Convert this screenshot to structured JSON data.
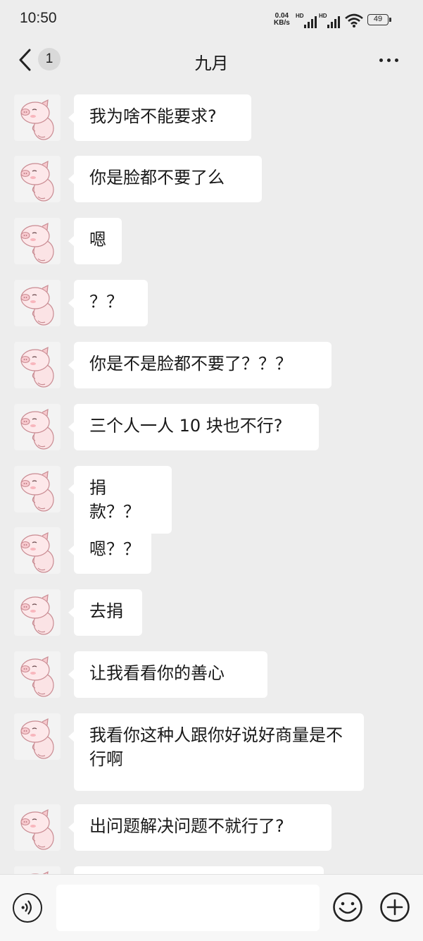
{
  "status_bar": {
    "time": "10:50",
    "net_speed_value": "0.04",
    "net_speed_unit": "KB/s",
    "signal1_label": "HD",
    "signal2_label": "HD",
    "battery": "49"
  },
  "header": {
    "unread_count": "1",
    "title": "九月"
  },
  "messages": [
    {
      "text": "我为啥不能要求?"
    },
    {
      "text": "你是脸都不要了么"
    },
    {
      "text": "嗯"
    },
    {
      "text": "？？"
    },
    {
      "text": "你是不是脸都不要了？？？"
    },
    {
      "text": "三个人一人 10 块也不行?"
    },
    {
      "text": "捐款？？"
    },
    {
      "text": "嗯？？"
    },
    {
      "text": "去捐"
    },
    {
      "text": "让我看看你的善心"
    },
    {
      "text": "我看你这种人跟你好说好商量是不行啊"
    },
    {
      "text": "出问题解决问题不就行了?"
    },
    {
      "text": ""
    }
  ],
  "input": {
    "value": "",
    "placeholder": ""
  },
  "icons": {
    "back": "chevron-left-icon",
    "more": "more-dots-icon",
    "voice": "voice-icon",
    "emoji": "emoji-icon",
    "plus": "plus-icon",
    "avatar": "pig-avatar"
  },
  "colors": {
    "background": "#ededed",
    "bubble": "#ffffff",
    "input_bar": "#f7f7f7",
    "avatar_pig": "#f8d3d6"
  }
}
